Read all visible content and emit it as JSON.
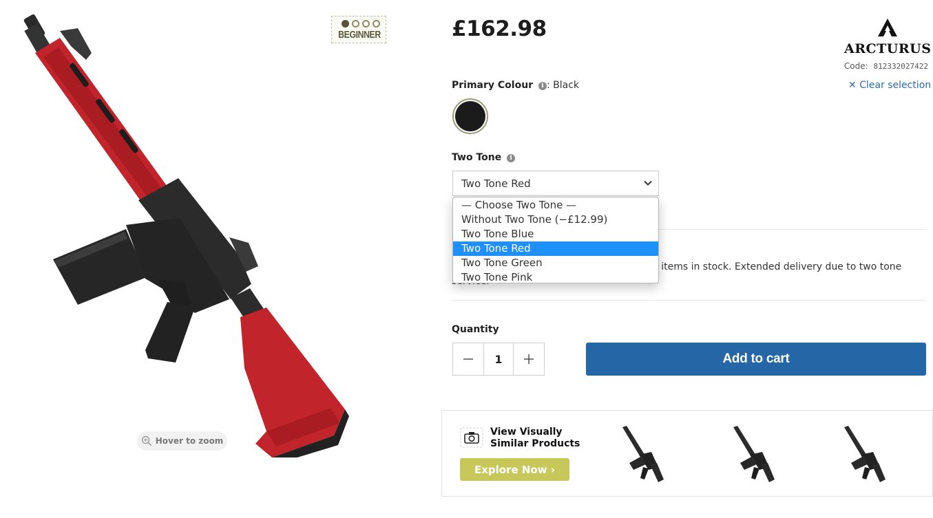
{
  "product": {
    "price": "£162.98",
    "brand": "ARCTURUS",
    "code_label": "Code:",
    "code_value": "812332027422",
    "skill_badge": "BEGINNER",
    "skill_level": 1,
    "skill_level_max": 4
  },
  "gallery": {
    "zoom_hint": "Hover to zoom"
  },
  "primary_colour": {
    "label": "Primary Colour",
    "selected_value": ": Black",
    "clear_label": "Clear selection",
    "swatch_color": "#1b1b1b"
  },
  "two_tone": {
    "label": "Two Tone",
    "selected": "Two Tone Red",
    "options": [
      "— Choose Two Tone —",
      "Without Two Tone (−£12.99)",
      "Two Tone Blue",
      "Two Tone Red",
      "Two Tone Green",
      "Two Tone Pink"
    ],
    "highlighted_index": 3
  },
  "stock_note_visible_prefix": "gh items in stock. Extended delivery due to two tone",
  "stock_note_visible_line2": "service.",
  "quantity": {
    "label": "Quantity",
    "value": "1"
  },
  "cart": {
    "add_label": "Add to cart",
    "accent_color": "#2566a6"
  },
  "similar": {
    "title_line1": "View Visually",
    "title_line2": "Similar Products",
    "explore_label": "Explore Now ›",
    "explore_color": "#c8c75a"
  }
}
